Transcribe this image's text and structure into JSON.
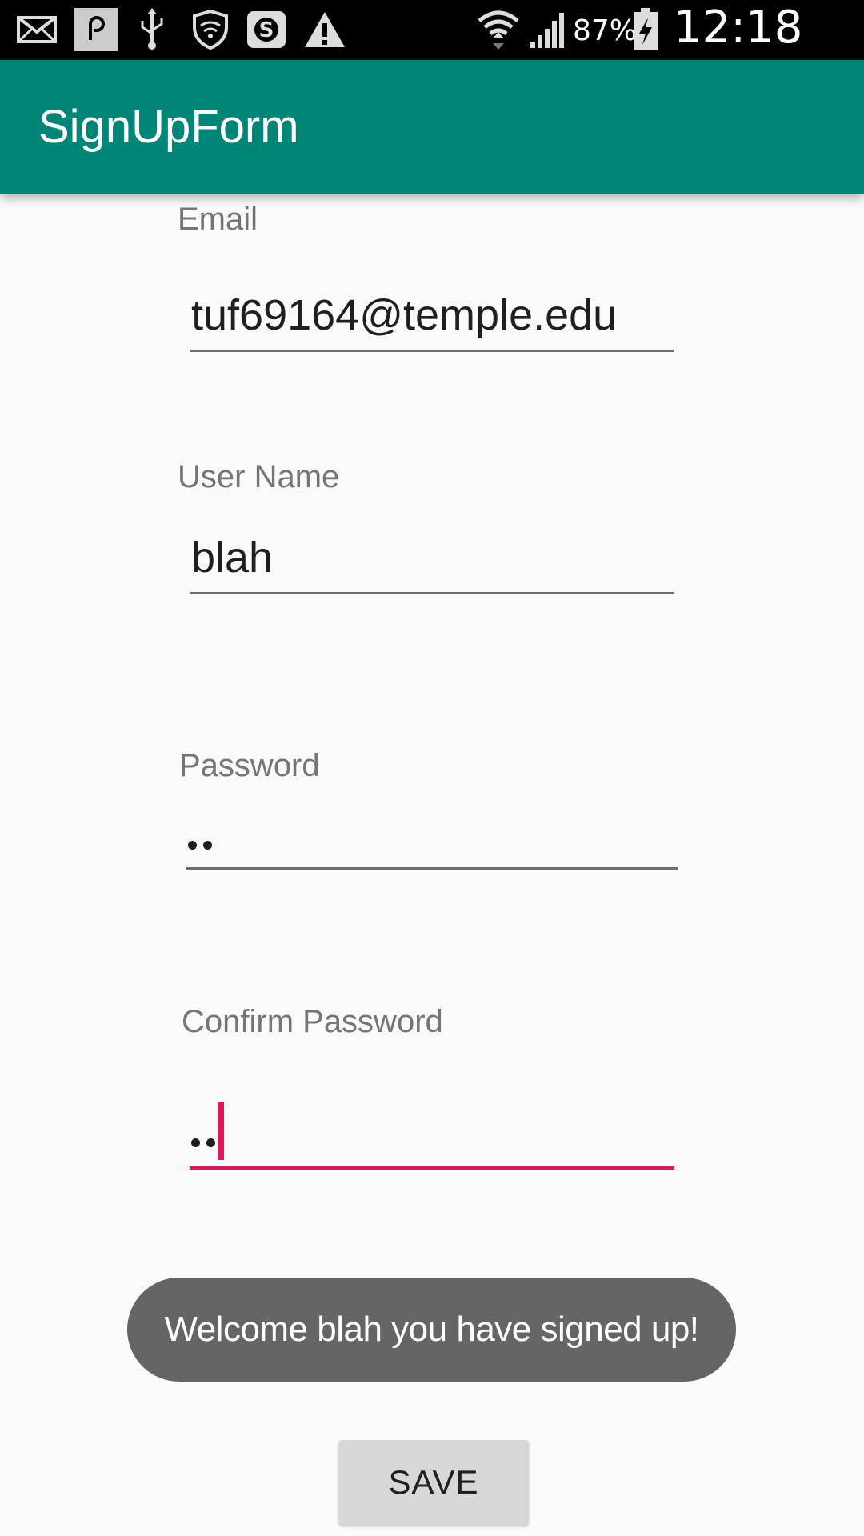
{
  "status_bar": {
    "icons": [
      "mail-icon",
      "pocket-icon",
      "usb-icon",
      "shield-icon",
      "s-app-icon",
      "warning-icon",
      "wifi-icon",
      "signal-icon",
      "battery-icon"
    ],
    "battery_percent": "87%",
    "time": "12:18 PM"
  },
  "app_bar": {
    "title": "SignUpForm",
    "color": "#008577"
  },
  "form": {
    "email_label": "Email",
    "email_value": "tuf69164@temple.edu",
    "username_label": "User Name",
    "username_value": "blah",
    "password_label": "Password",
    "password_dot_count": 2,
    "confirm_password_label": "Confirm Password",
    "confirm_password_dot_count": 2,
    "accent_color": "#d81b60"
  },
  "toast": {
    "message": "Welcome blah you have signed up!"
  },
  "save_button": {
    "label": "SAVE"
  }
}
